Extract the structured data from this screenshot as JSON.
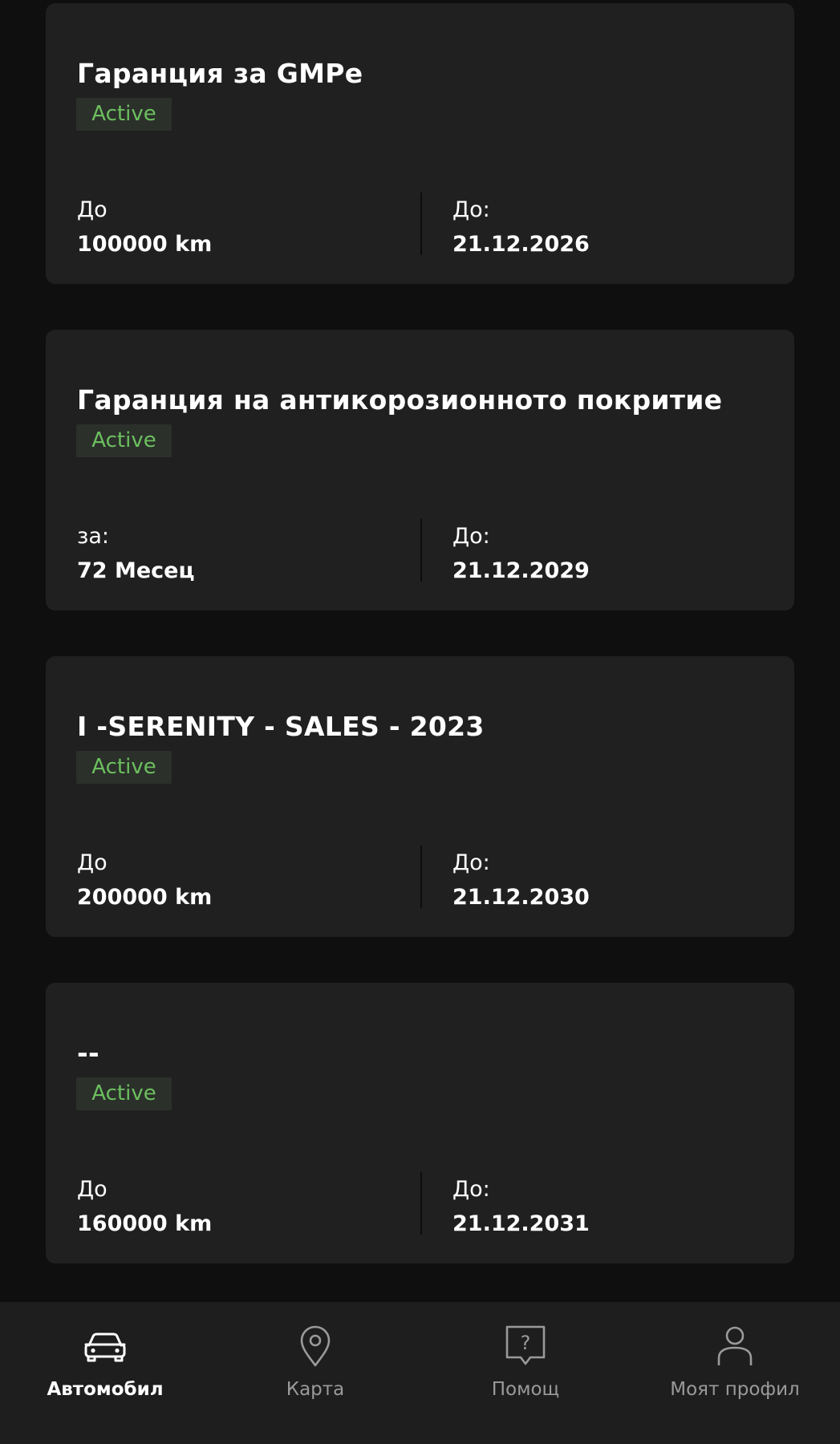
{
  "cards": [
    {
      "title": "Гаранция за GMPe",
      "status": "Active",
      "left_label": "До",
      "left_value": "100000 km",
      "right_label": "До:",
      "right_value": "21.12.2026"
    },
    {
      "title": "Гаранция на антикорозионното покритие",
      "status": "Active",
      "left_label": "за:",
      "left_value": "72 Месец",
      "right_label": "До:",
      "right_value": "21.12.2029"
    },
    {
      "title": "I -SERENITY - SALES - 2023",
      "status": "Active",
      "left_label": "До",
      "left_value": "200000 km",
      "right_label": "До:",
      "right_value": "21.12.2030"
    },
    {
      "title": "--",
      "status": "Active",
      "left_label": "До",
      "left_value": "160000 km",
      "right_label": "До:",
      "right_value": "21.12.2031"
    }
  ],
  "bottom_nav": {
    "items": [
      {
        "label": "Автомобил",
        "icon": "car-icon",
        "active": true
      },
      {
        "label": "Карта",
        "icon": "map-pin-icon",
        "active": false
      },
      {
        "label": "Помощ",
        "icon": "help-icon",
        "active": false
      },
      {
        "label": "Моят профил",
        "icon": "profile-icon",
        "active": false
      }
    ]
  },
  "colors": {
    "background": "#0f0f0f",
    "card": "#202020",
    "badge_bg": "#2b302b",
    "badge_text": "#6cbf5e",
    "nav_bg": "#1e1e1e",
    "nav_inactive": "#9a9a9a"
  }
}
